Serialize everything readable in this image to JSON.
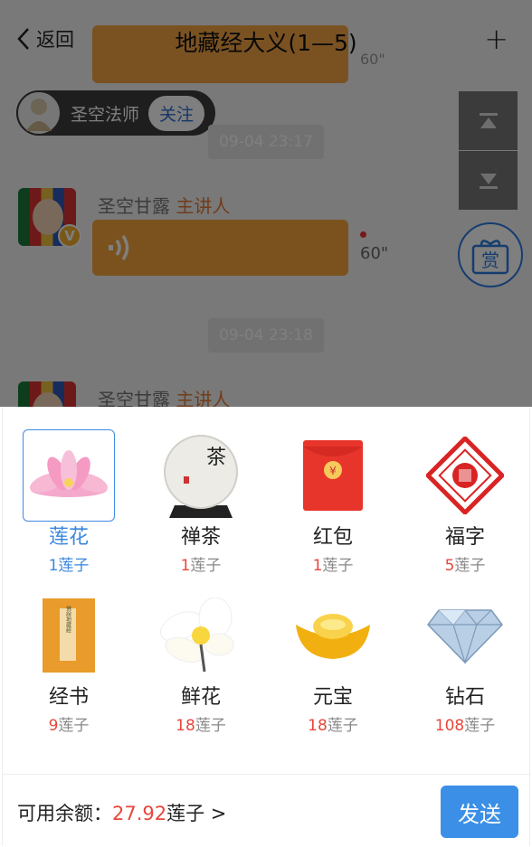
{
  "nav": {
    "back_label": "返回",
    "title": "地藏经大义(1—5)",
    "plus_label": "+"
  },
  "top_bubble_duration": "60\"",
  "author": {
    "name": "圣空法师",
    "follow_label": "关注"
  },
  "messages": [
    {
      "time": "09-04 23:17",
      "speaker": "圣空甘露",
      "role": "主讲人",
      "duration": "60\"",
      "badge": "V"
    },
    {
      "time": "09-04 23:18",
      "speaker": "圣空甘露",
      "role": "主讲人"
    }
  ],
  "reward_label": "赏",
  "gifts": [
    {
      "name": "莲花",
      "price": "1",
      "unit": "莲子",
      "icon": "lotus-icon",
      "selected": true
    },
    {
      "name": "禅茶",
      "price": "1",
      "unit": "莲子",
      "icon": "tea-icon"
    },
    {
      "name": "红包",
      "price": "1",
      "unit": "莲子",
      "icon": "red-envelope-icon"
    },
    {
      "name": "福字",
      "price": "5",
      "unit": "莲子",
      "icon": "fu-character-icon"
    },
    {
      "name": "经书",
      "price": "9",
      "unit": "莲子",
      "icon": "sutra-book-icon"
    },
    {
      "name": "鲜花",
      "price": "18",
      "unit": "莲子",
      "icon": "flower-icon"
    },
    {
      "name": "元宝",
      "price": "18",
      "unit": "莲子",
      "icon": "gold-ingot-icon"
    },
    {
      "name": "钻石",
      "price": "108",
      "unit": "莲子",
      "icon": "diamond-icon"
    }
  ],
  "tea_glyph": "茶",
  "book_text": "佛說地藏經",
  "envelope_symbol": "¥",
  "footer": {
    "balance_label": "可用余额：",
    "balance_amount": "27.92",
    "balance_unit": "莲子 >",
    "send_label": "发送"
  },
  "colors": {
    "accent": "#3b8fe6",
    "price": "#e8463b",
    "voice": "#f7a43d"
  }
}
